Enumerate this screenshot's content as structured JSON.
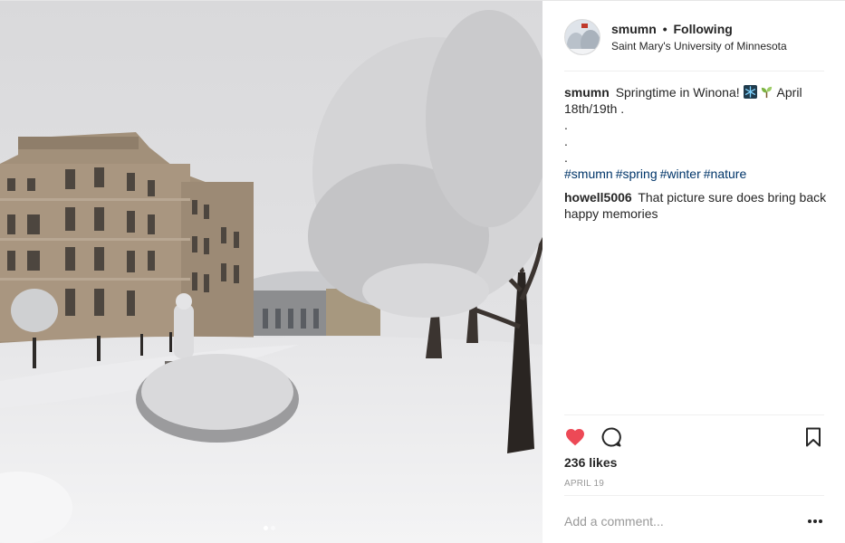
{
  "post": {
    "image": {
      "alt": "",
      "carousel_count": 2,
      "carousel_active_index": 0
    },
    "header": {
      "username": "smumn",
      "separator": "•",
      "follow_status": "Following",
      "location": "Saint Mary's University of Minnesota"
    },
    "caption": {
      "username": "smumn",
      "text_before": "Springtime in Winona!",
      "emoji_1": "snowflake-icon",
      "emoji_2": "seedling-icon",
      "text_after": "April 18th/19th .",
      "dots": [
        ".",
        ".",
        "."
      ],
      "hashtags": [
        "#smumn",
        "#spring",
        "#winter",
        "#nature"
      ]
    },
    "comments": [
      {
        "username": "howell5006",
        "text": "That picture sure does bring back happy memories"
      }
    ],
    "actions": {
      "like_icon": "heart-icon",
      "comment_icon": "comment-icon",
      "save_icon": "bookmark-icon",
      "liked": true
    },
    "likes_text": "236 likes",
    "date": "APRIL 19",
    "add_comment": {
      "placeholder": "Add a comment...",
      "more_icon": "ellipsis-icon"
    }
  },
  "colors": {
    "heart": "#ed4956",
    "hashtag": "#003569",
    "muted": "#999999",
    "text": "#262626",
    "divider": "#efefef"
  }
}
